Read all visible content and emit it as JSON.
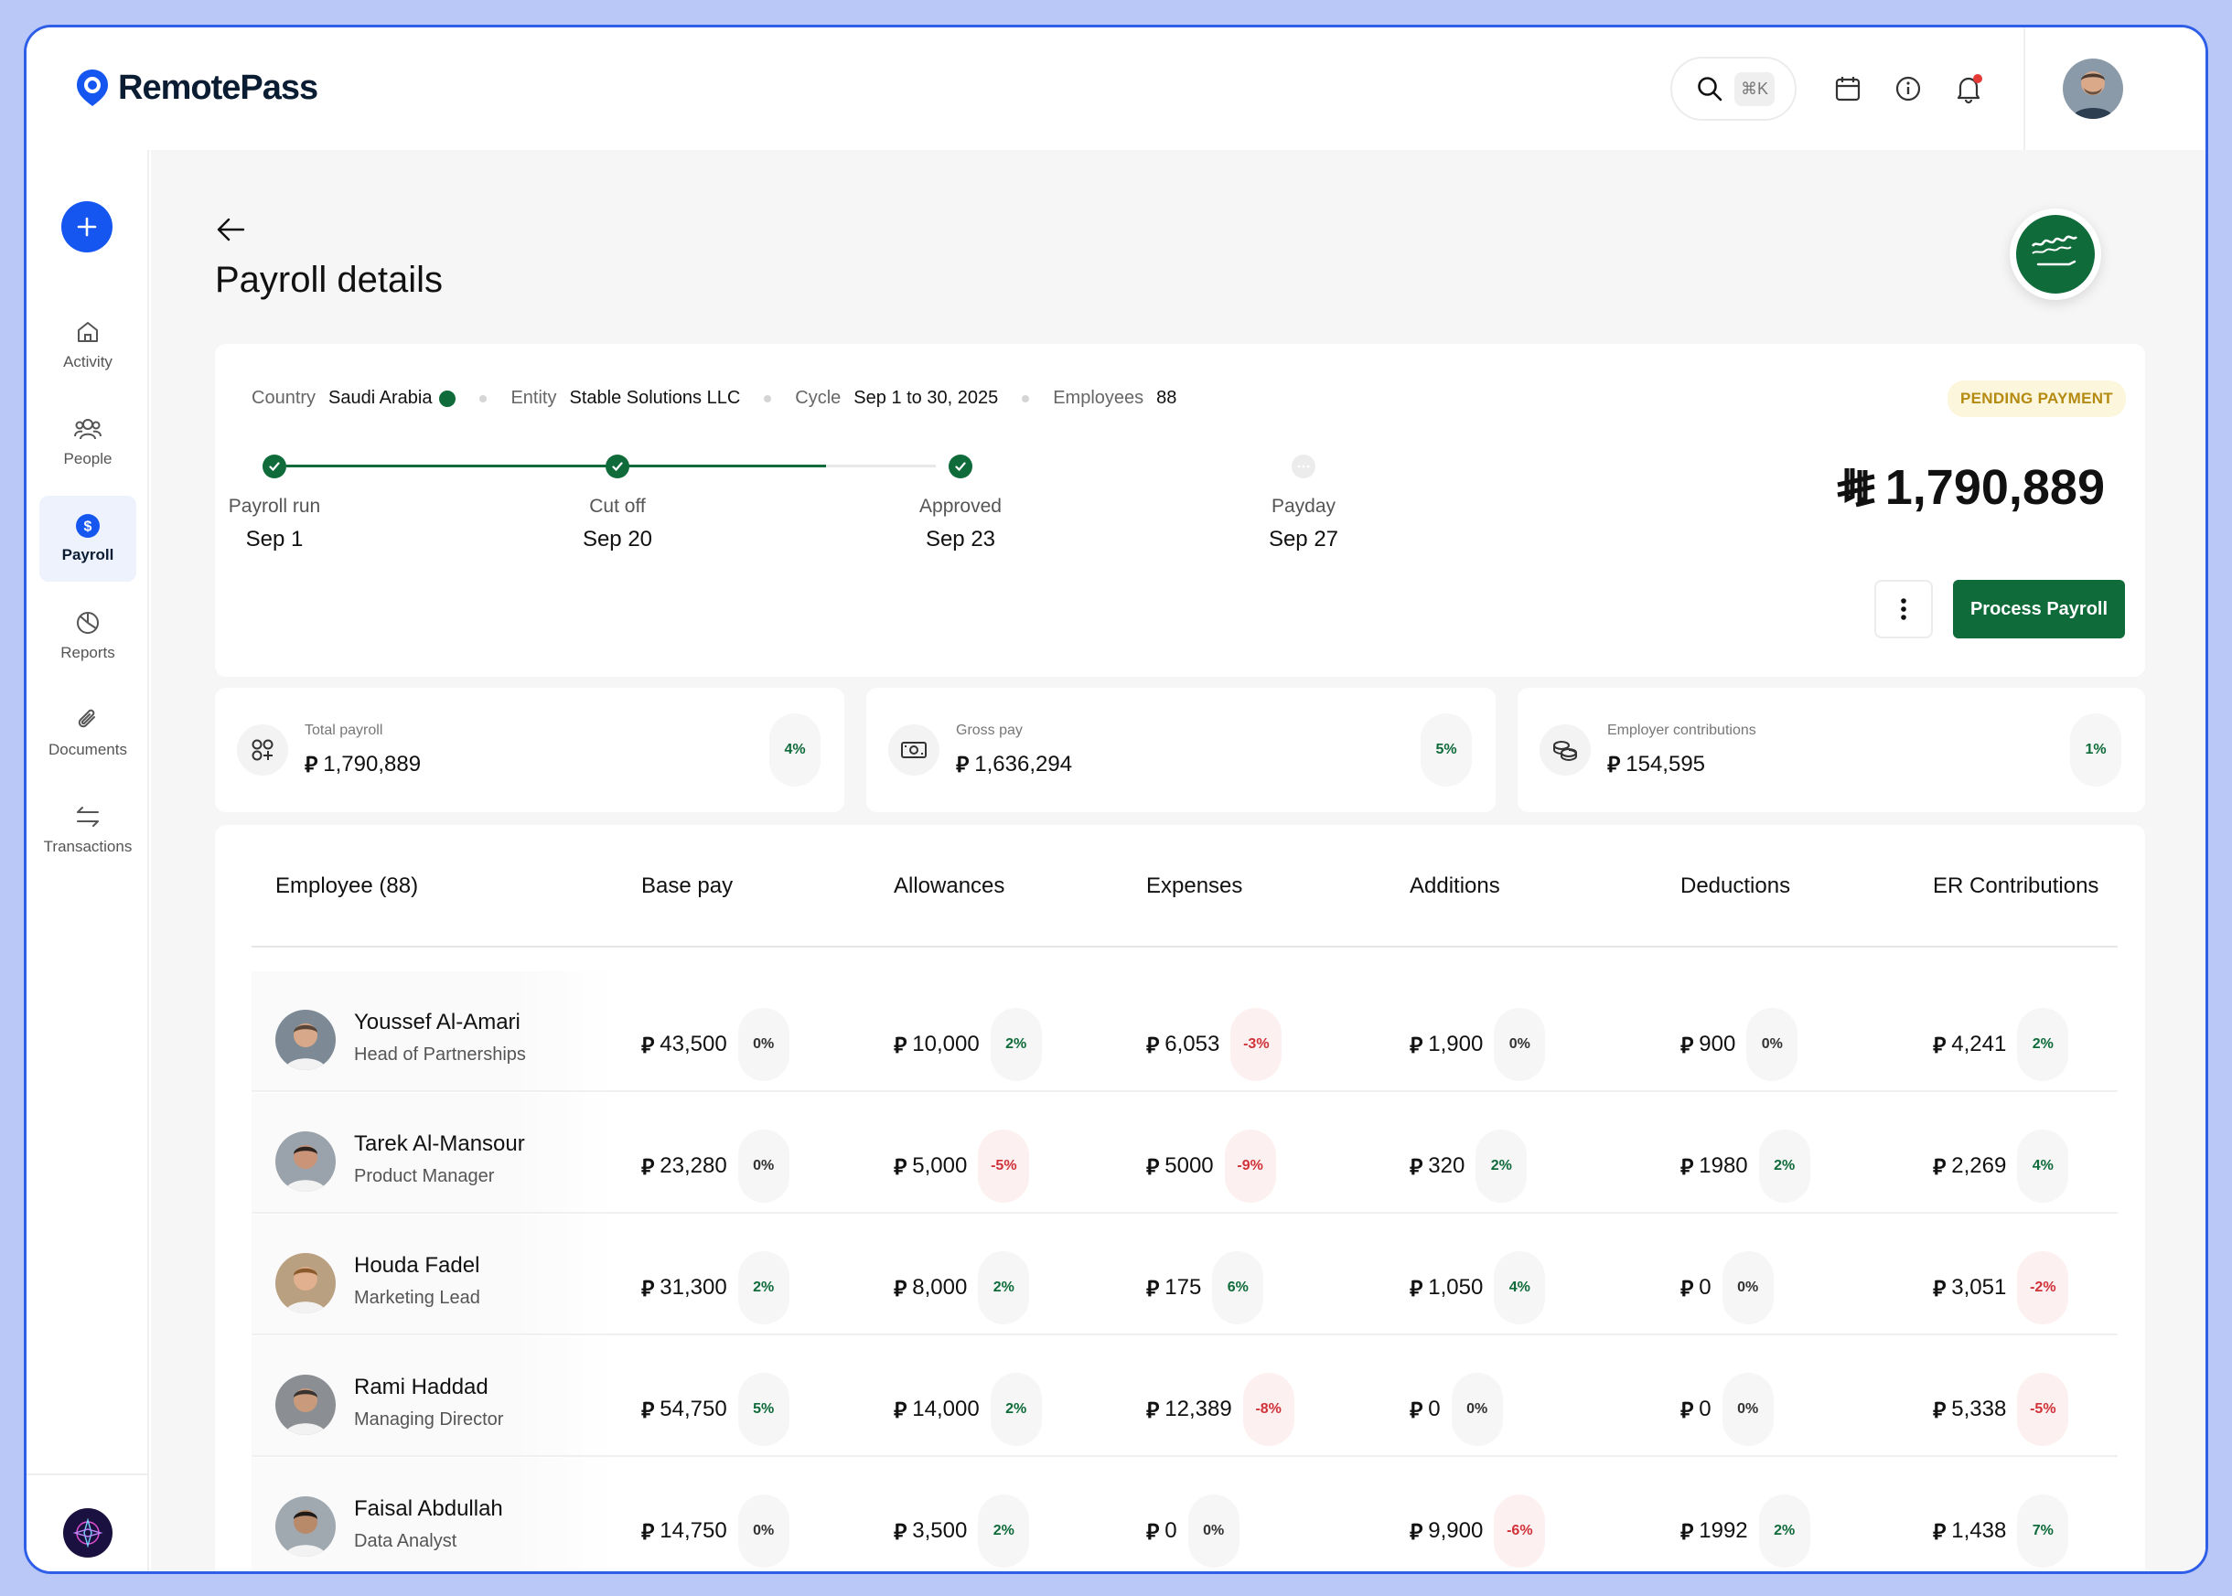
{
  "brand": {
    "name": "RemotePass",
    "accent": "#1656f0",
    "green": "#0f6b3a"
  },
  "header": {
    "search_shortcut": "⌘K"
  },
  "sidebar": {
    "items": [
      {
        "label": "Activity",
        "icon": "home-icon"
      },
      {
        "label": "People",
        "icon": "people-icon"
      },
      {
        "label": "Payroll",
        "icon": "dollar-icon",
        "active": true
      },
      {
        "label": "Reports",
        "icon": "pie-chart-icon"
      },
      {
        "label": "Documents",
        "icon": "paperclip-icon"
      },
      {
        "label": "Transactions",
        "icon": "transfer-icon"
      }
    ]
  },
  "page": {
    "title": "Payroll details"
  },
  "summary": {
    "country_label": "Country",
    "country": "Saudi Arabia",
    "entity_label": "Entity",
    "entity": "Stable Solutions LLC",
    "cycle_label": "Cycle",
    "cycle": "Sep 1 to 30, 2025",
    "employees_label": "Employees",
    "employees": "88",
    "status": "PENDING PAYMENT",
    "total": "1,790,889",
    "process_label": "Process Payroll",
    "steps": [
      {
        "label": "Payroll run",
        "date": "Sep 1",
        "done": true
      },
      {
        "label": "Cut off",
        "date": "Sep 20",
        "done": true
      },
      {
        "label": "Approved",
        "date": "Sep 23",
        "done": true
      },
      {
        "label": "Payday",
        "date": "Sep 27",
        "done": false
      }
    ]
  },
  "stats": [
    {
      "label": "Total payroll",
      "value": "1,790,889",
      "pct": "4%",
      "icon": "shapes-icon"
    },
    {
      "label": "Gross pay",
      "value": "1,636,294",
      "pct": "5%",
      "icon": "cash-icon"
    },
    {
      "label": "Employer contributions",
      "value": "154,595",
      "pct": "1%",
      "icon": "coins-icon"
    }
  ],
  "table": {
    "columns": [
      "Employee (88)",
      "Base pay",
      "Allowances",
      "Expenses",
      "Additions",
      "Deductions",
      "ER Contributions"
    ],
    "rows": [
      {
        "name": "Youssef Al-Amari",
        "role": "Head of Partnerships",
        "cells": [
          [
            "43,500",
            "0%"
          ],
          [
            "10,000",
            "2%"
          ],
          [
            "6,053",
            "-3%"
          ],
          [
            "1,900",
            "0%"
          ],
          [
            "900",
            "0%"
          ],
          [
            "4,241",
            "2%"
          ]
        ]
      },
      {
        "name": "Tarek Al-Mansour",
        "role": "Product Manager",
        "cells": [
          [
            "23,280",
            "0%"
          ],
          [
            "5,000",
            "-5%"
          ],
          [
            "5000",
            "-9%"
          ],
          [
            "320",
            "2%"
          ],
          [
            "1980",
            "2%"
          ],
          [
            "2,269",
            "4%"
          ]
        ]
      },
      {
        "name": "Houda Fadel",
        "role": "Marketing Lead",
        "cells": [
          [
            "31,300",
            "2%"
          ],
          [
            "8,000",
            "2%"
          ],
          [
            "175",
            "6%"
          ],
          [
            "1,050",
            "4%"
          ],
          [
            "0",
            "0%"
          ],
          [
            "3,051",
            "-2%"
          ]
        ]
      },
      {
        "name": "Rami Haddad",
        "role": "Managing Director",
        "cells": [
          [
            "54,750",
            "5%"
          ],
          [
            "14,000",
            "2%"
          ],
          [
            "12,389",
            "-8%"
          ],
          [
            "0",
            "0%"
          ],
          [
            "0",
            "0%"
          ],
          [
            "5,338",
            "-5%"
          ]
        ]
      },
      {
        "name": "Faisal Abdullah",
        "role": "Data Analyst",
        "cells": [
          [
            "14,750",
            "0%"
          ],
          [
            "3,500",
            "2%"
          ],
          [
            "0",
            "0%"
          ],
          [
            "9,900",
            "-6%"
          ],
          [
            "1992",
            "2%"
          ],
          [
            "1,438",
            "7%"
          ]
        ]
      }
    ]
  }
}
